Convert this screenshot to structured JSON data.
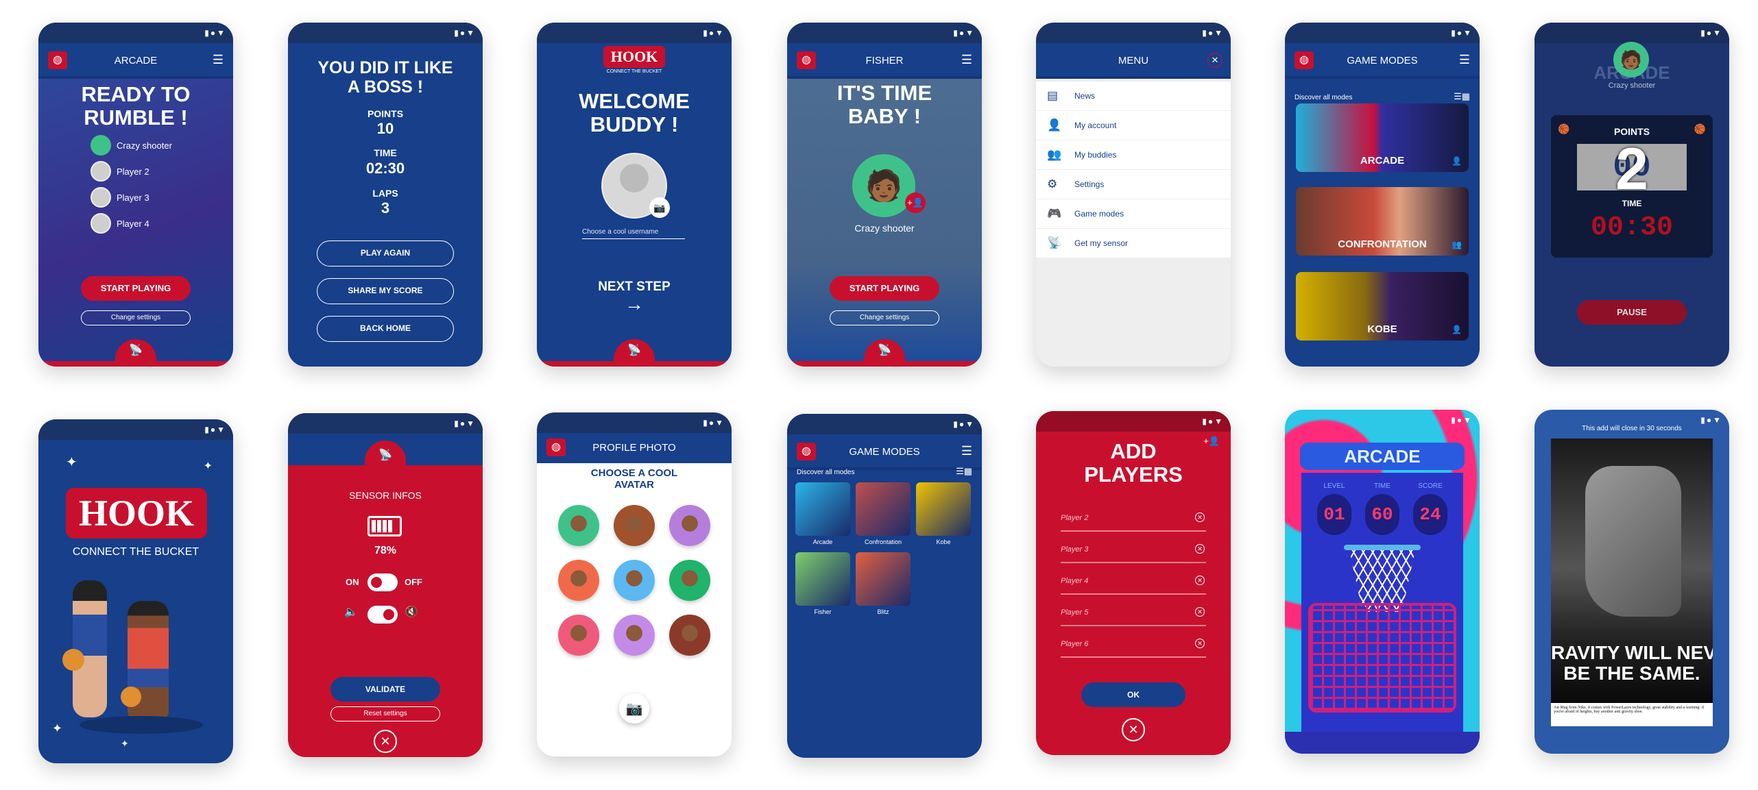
{
  "status_icons": "▮●▼",
  "colors": {
    "primary_blue": "#173f8a",
    "accent_red": "#c8102e",
    "status_bar": "#1b3468"
  },
  "s1": {
    "header": "ARCADE",
    "title": "READY TO RUMBLE !",
    "players": [
      "Crazy shooter",
      "Player 2",
      "Player 3",
      "Player 4"
    ],
    "start": "START PLAYING",
    "settings": "Change settings"
  },
  "s2": {
    "title": "YOU DID IT LIKE A BOSS !",
    "points_label": "POINTS",
    "points": "10",
    "time_label": "TIME",
    "time": "02:30",
    "laps_label": "LAPS",
    "laps": "3",
    "buttons": [
      "PLAY AGAIN",
      "SHARE MY SCORE",
      "BACK HOME"
    ]
  },
  "s3": {
    "logo": "HOOK",
    "tagline": "CONNECT THE BUCKET",
    "title": "WELCOME BUDDY !",
    "username_placeholder": "Choose a cool username",
    "next": "NEXT STEP",
    "arrow": "→"
  },
  "s4": {
    "header": "FISHER",
    "title": "IT'S TIME BABY !",
    "player": "Crazy shooter",
    "start": "START PLAYING",
    "settings": "Change settings"
  },
  "s5": {
    "header": "MENU",
    "items": [
      {
        "icon": "news-icon",
        "glyph": "▤",
        "label": "News"
      },
      {
        "icon": "user-icon",
        "glyph": "👤",
        "label": "My account"
      },
      {
        "icon": "buddies-icon",
        "glyph": "👥",
        "label": "My buddies"
      },
      {
        "icon": "gear-icon",
        "glyph": "⚙",
        "label": "Settings"
      },
      {
        "icon": "gamepad-icon",
        "glyph": "🎮",
        "label": "Game modes"
      },
      {
        "icon": "sensor-icon",
        "glyph": "📡",
        "label": "Get my sensor"
      }
    ]
  },
  "s6": {
    "header": "GAME MODES",
    "discover": "Discover all modes",
    "cards": [
      {
        "label": "ARCADE",
        "players": "single"
      },
      {
        "label": "CONFRONTATION",
        "players": "multi"
      },
      {
        "label": "KOBE",
        "players": "single"
      }
    ]
  },
  "s7": {
    "player": "Crazy shooter",
    "bg_title": "ARCADE",
    "points_label": "POINTS",
    "points": "00",
    "countdown": "2",
    "time_label": "TIME",
    "time": "00:30",
    "pause": "PAUSE"
  },
  "s8": {
    "logo": "HOOK",
    "tagline": "CONNECT THE BUCKET"
  },
  "s9": {
    "title": "SENSOR INFOS",
    "battery": "78%",
    "battery_level": 78,
    "on": "ON",
    "off": "OFF",
    "power_state": "on",
    "sound_state": "on",
    "validate": "VALIDATE",
    "reset": "Reset settings"
  },
  "s10": {
    "header": "PROFILE PHOTO",
    "title": "CHOOSE A COOL AVATAR",
    "avatar_colors": [
      "#3fc28a",
      "#a0522d",
      "#b57edc",
      "#f06a4a",
      "#5bb8f0",
      "#1fb36b",
      "#f05a7a",
      "#c48ae8",
      "#8b3a2a"
    ]
  },
  "s11": {
    "header": "GAME MODES",
    "discover": "Discover all modes",
    "modes": [
      {
        "label": "Arcade",
        "color": "#2bb5e8"
      },
      {
        "label": "Confrontation",
        "color": "#c0504d"
      },
      {
        "label": "Kobe",
        "color": "#f2c300"
      },
      {
        "label": "Fisher",
        "color": "#7fcf6b"
      },
      {
        "label": "Blitz",
        "color": "#e06040"
      }
    ]
  },
  "s12": {
    "title": "ADD PLAYERS",
    "fields": [
      "Player 2",
      "Player 3",
      "Player 4",
      "Player 5",
      "Player 6"
    ],
    "ok": "OK"
  },
  "s13": {
    "title": "ARCADE",
    "labels": [
      "LEVEL",
      "TIME",
      "SCORE"
    ],
    "values": [
      "01",
      "60",
      "24"
    ]
  },
  "s14": {
    "notice": "This add will close in 30 seconds",
    "headline1": "RAVITY WILL NEV",
    "headline2": "BE THE SAME.",
    "fineprint": "Air Mag from Nike. It comes with PowerLaces technology, great stability and a warning: if you're afraid of heights, buy another anti gravity shoe."
  }
}
